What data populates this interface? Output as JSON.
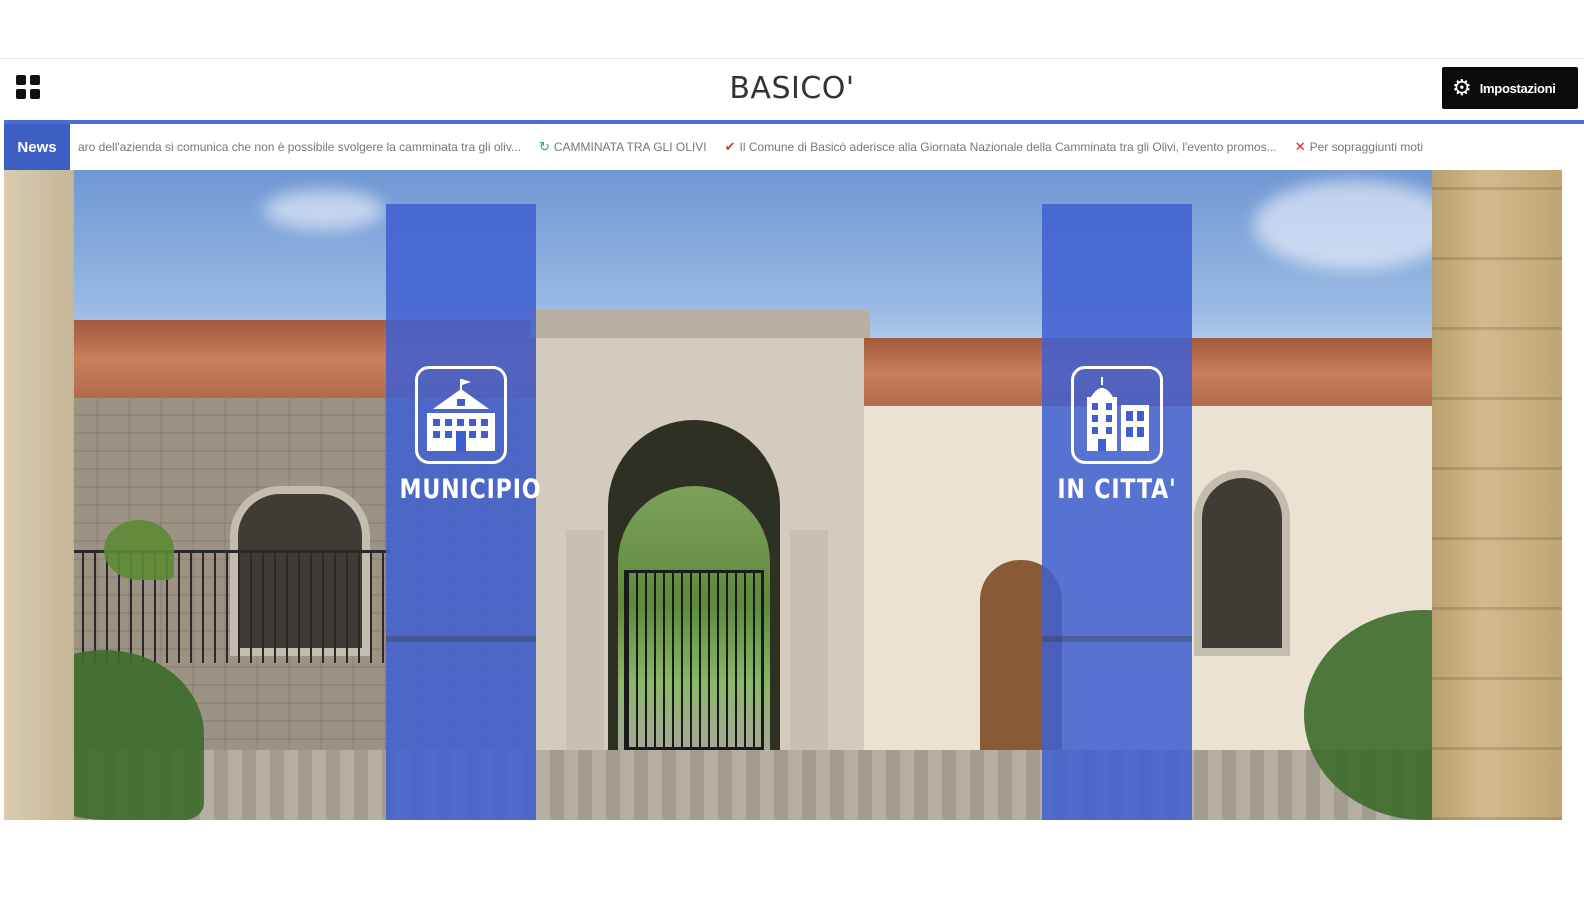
{
  "header": {
    "title": "BASICO'",
    "settings_label": "Impostazioni"
  },
  "ticker": {
    "label": "News",
    "items": [
      {
        "icon": "",
        "text": "aro dell'azienda si comunica che non è possibile svolgere la camminata tra gli oliv..."
      },
      {
        "icon": "↻",
        "icon_color": "#2aa84a",
        "text": "CAMMINATA TRA GLI OLIVI"
      },
      {
        "icon": "✔",
        "icon_color": "#d83a2a",
        "text": "Il Comune di Basicò aderisce alla Giornata Nazionale della Camminata tra gli Olivi, l'evento promos..."
      },
      {
        "icon": "✕",
        "icon_color": "#e02020",
        "text": "Per sopraggiunti moti"
      }
    ]
  },
  "tiles": [
    {
      "label": "MUNICIPIO",
      "icon": "town-hall-icon"
    },
    {
      "label": "IN CITTA'",
      "icon": "city-buildings-icon"
    }
  ],
  "colors": {
    "accent": "#3f5fd0",
    "ticker_label_bg": "#3d5fc4",
    "settings_bg": "#0b0b0b"
  }
}
